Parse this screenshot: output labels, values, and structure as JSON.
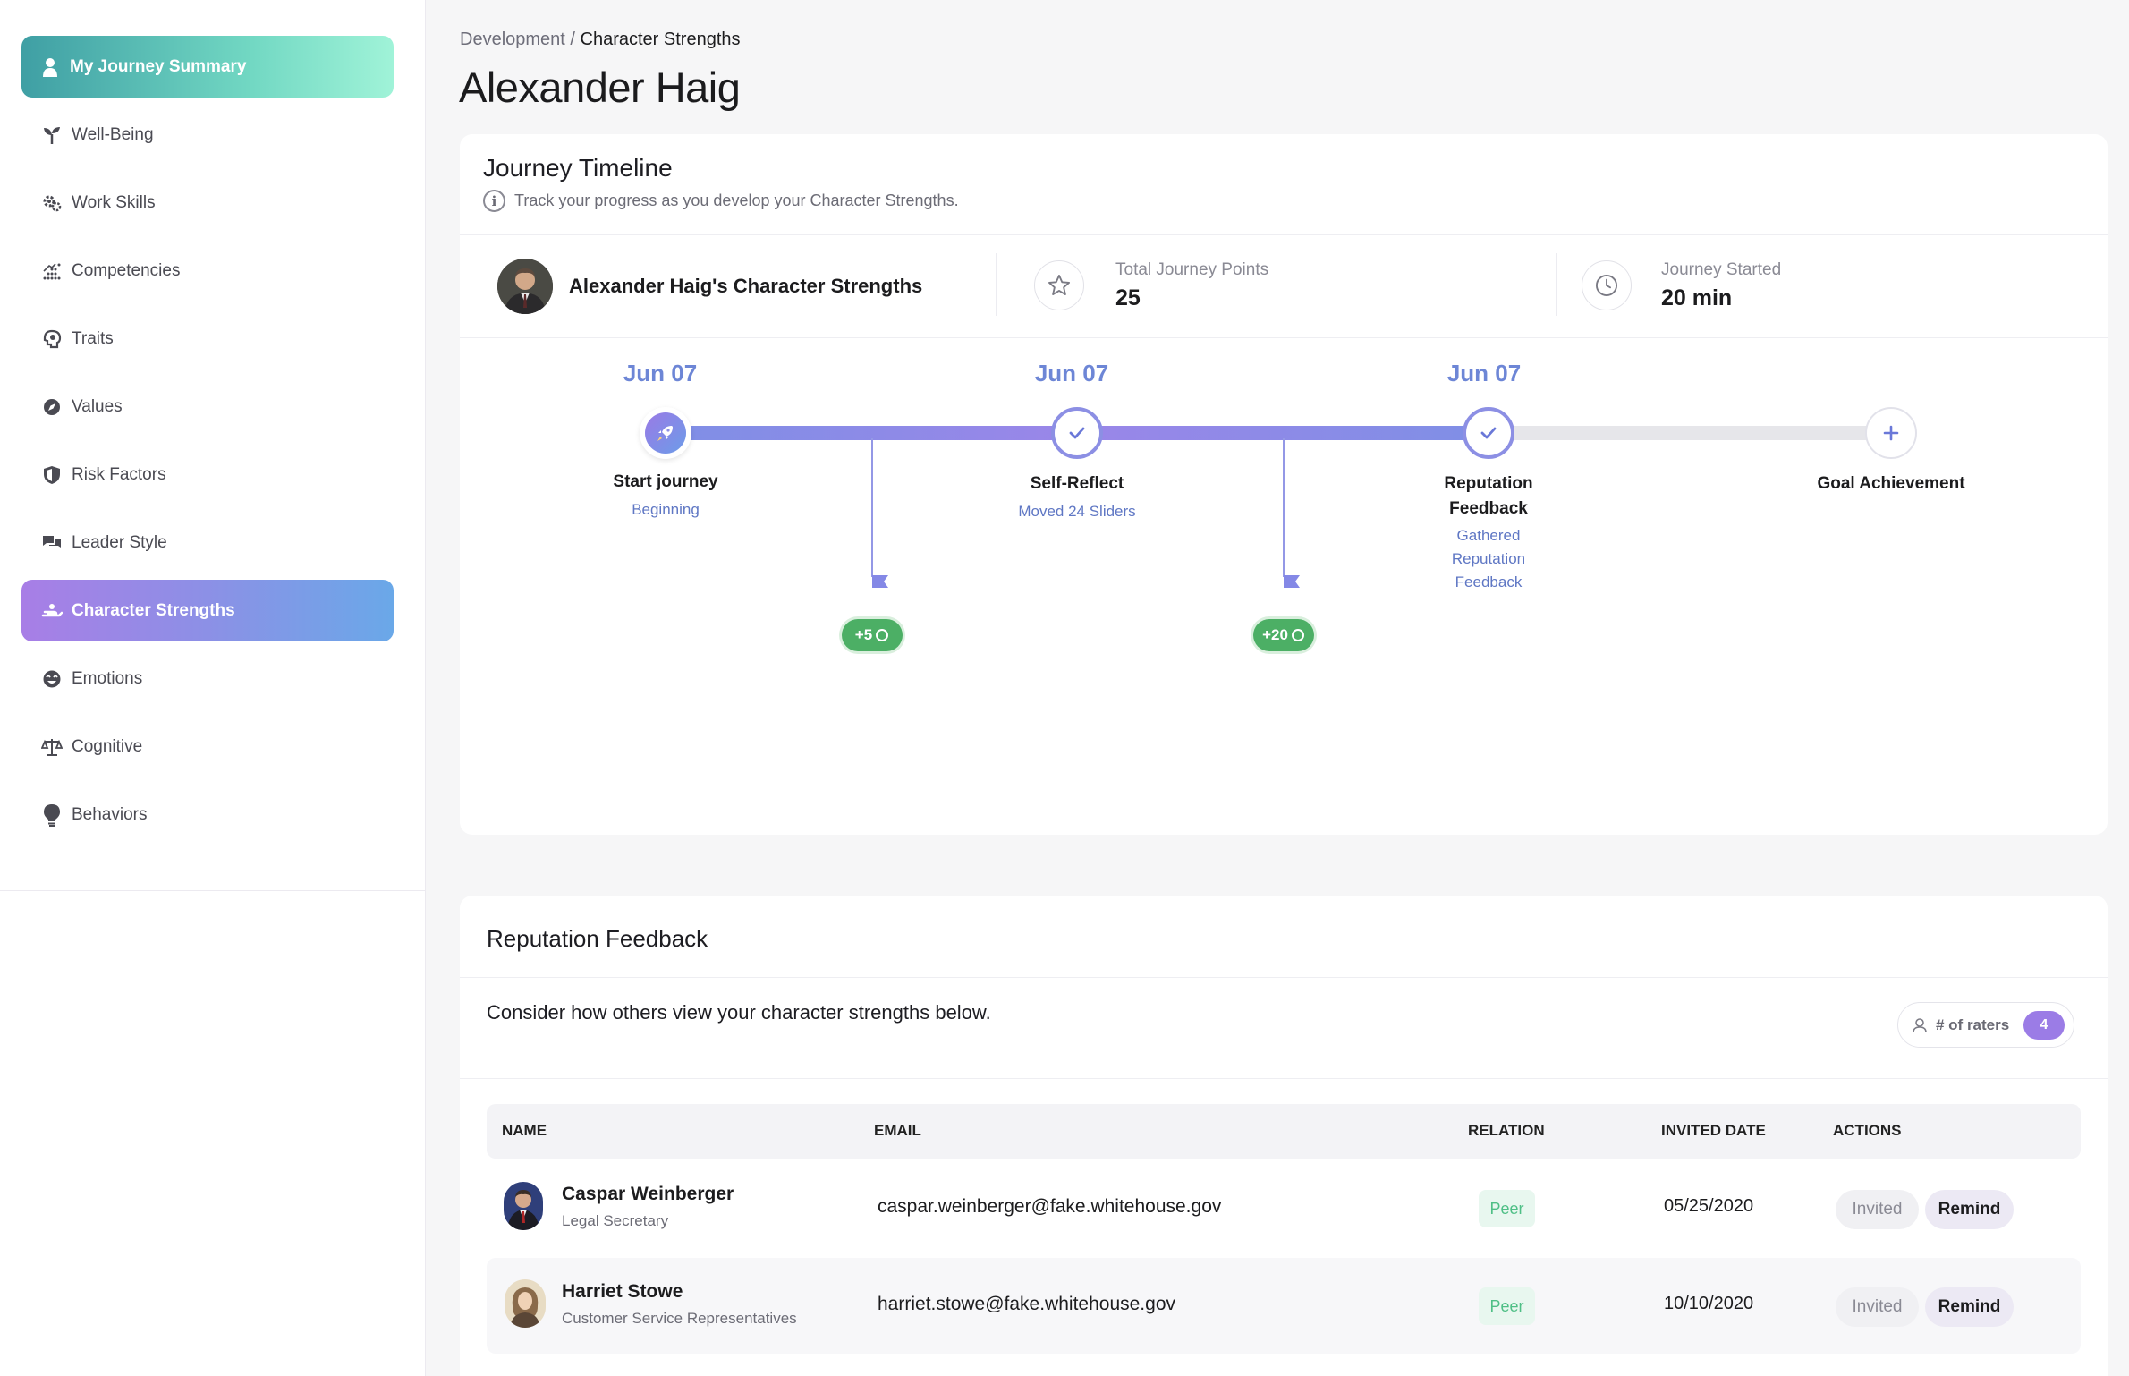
{
  "sidebar": {
    "items": [
      {
        "label": "My Journey Summary",
        "icon": "user-icon"
      },
      {
        "label": "Well-Being",
        "icon": "sprout-icon"
      },
      {
        "label": "Work Skills",
        "icon": "gears-icon"
      },
      {
        "label": "Competencies",
        "icon": "chart-dots-icon"
      },
      {
        "label": "Traits",
        "icon": "brain-head-icon"
      },
      {
        "label": "Values",
        "icon": "compass-icon"
      },
      {
        "label": "Risk Factors",
        "icon": "shield-icon"
      },
      {
        "label": "Leader Style",
        "icon": "chat-bubbles-icon"
      },
      {
        "label": "Character Strengths",
        "icon": "hands-icon"
      },
      {
        "label": "Emotions",
        "icon": "smile-icon"
      },
      {
        "label": "Cognitive",
        "icon": "balance-scale-icon"
      },
      {
        "label": "Behaviors",
        "icon": "lightbulb-icon"
      }
    ],
    "active": "Character Strengths"
  },
  "breadcrumb": {
    "parent": "Development",
    "separator": "/",
    "current": "Character Strengths"
  },
  "page_title": "Alexander Haig",
  "timeline": {
    "title": "Journey Timeline",
    "subtitle": "Track your progress as you develop your Character Strengths.",
    "info_icon": "i",
    "stats": {
      "name": "Alexander Haig's Character Strengths",
      "points_label": "Total Journey Points",
      "points_value": "25",
      "started_label": "Journey Started",
      "started_value": "20 min"
    },
    "steps": [
      {
        "date": "Jun 07",
        "label": "Start journey",
        "sub": "Beginning",
        "status": "start"
      },
      {
        "date": "Jun 07",
        "label": "Self-Reflect",
        "sub": "Moved 24 Sliders",
        "status": "done"
      },
      {
        "date": "Jun 07",
        "label_line1": "Reputation",
        "label_line2": "Feedback",
        "sub_line1": "Gathered",
        "sub_line2": "Reputation",
        "sub_line3": "Feedback",
        "status": "done"
      },
      {
        "label": "Goal Achievement",
        "status": "pending"
      }
    ],
    "milestones": [
      {
        "points": "+5"
      },
      {
        "points": "+20"
      }
    ]
  },
  "reputation": {
    "title": "Reputation Feedback",
    "description": "Consider how others view your character strengths below.",
    "raters_label": "# of raters",
    "raters_count": "4",
    "columns": [
      "NAME",
      "EMAIL",
      "RELATION",
      "INVITED DATE",
      "ACTIONS"
    ],
    "rows": [
      {
        "name": "Caspar Weinberger",
        "role": "Legal Secretary",
        "email": "caspar.weinberger@fake.whitehouse.gov",
        "relation": "Peer",
        "date": "05/25/2020",
        "status": "Invited",
        "action": "Remind"
      },
      {
        "name": "Harriet Stowe",
        "role": "Customer Service Representatives",
        "email": "harriet.stowe@fake.whitehouse.gov",
        "relation": "Peer",
        "date": "10/10/2020",
        "status": "Invited",
        "action": "Remind"
      }
    ]
  },
  "colors": {
    "accent_purple": "#8c8fe4",
    "teal": "#3f9fa4",
    "green": "#4caf65",
    "date_blue": "#6d86d6"
  }
}
